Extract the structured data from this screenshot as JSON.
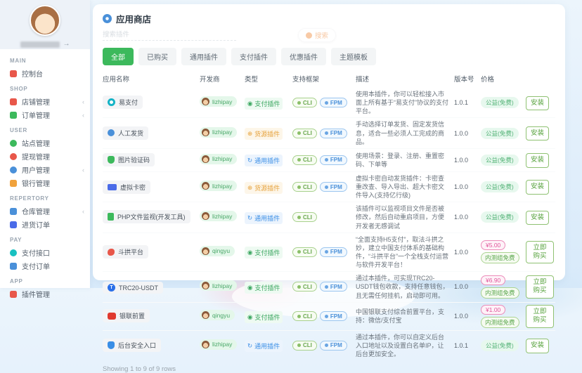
{
  "colors": {
    "accent_green": "#3cb95c",
    "type_pay_green": "#3aa65f",
    "type_stock_orange": "#e6a23c",
    "type_common_blue": "#3a8ee6",
    "cli_badge_green": "#6aa84f",
    "fpm_badge_blue": "#4a90d9",
    "price_paid_pink": "#e0549a",
    "free_badge_green": "#53b276",
    "search_orange": "#f08c3c"
  },
  "sidebar": {
    "groups": [
      {
        "label": "MAIN",
        "items": [
          {
            "label": "控制台",
            "icon": "dashboard-icon"
          }
        ]
      },
      {
        "label": "SHOP",
        "items": [
          {
            "label": "店铺管理",
            "icon": "shop-icon"
          },
          {
            "label": "订单管理",
            "icon": "orders-icon"
          }
        ]
      },
      {
        "label": "USER",
        "items": [
          {
            "label": "站点管理",
            "icon": "site-icon"
          },
          {
            "label": "提现管理",
            "icon": "withdraw-icon"
          },
          {
            "label": "用户管理",
            "icon": "users-icon"
          },
          {
            "label": "银行管理",
            "icon": "bank-icon"
          }
        ]
      },
      {
        "label": "REPERTORY",
        "items": [
          {
            "label": "仓库管理",
            "icon": "warehouse-icon"
          },
          {
            "label": "进货订单",
            "icon": "purchase-icon"
          }
        ]
      },
      {
        "label": "PAY",
        "items": [
          {
            "label": "支付接口",
            "icon": "pay-api-icon"
          },
          {
            "label": "支付订单",
            "icon": "pay-orders-icon"
          }
        ]
      },
      {
        "label": "APP",
        "items": [
          {
            "label": "插件管理",
            "icon": "plugins-icon"
          }
        ]
      }
    ]
  },
  "header": {
    "title": "应用商店",
    "search_placeholder": "搜索插件",
    "search_button": "搜索"
  },
  "tabs": {
    "items": [
      "全部",
      "已购买",
      "通用插件",
      "支付插件",
      "优惠插件",
      "主题模板"
    ],
    "active": "全部"
  },
  "table": {
    "columns": [
      "应用名称",
      "开发商",
      "类型",
      "支持框架",
      "描述",
      "版本号",
      "价格"
    ],
    "rows": [
      {
        "name": "易支付",
        "developer": "lizhipay",
        "type": "支付插件",
        "frameworks": [
          "CLI",
          "FPM"
        ],
        "description": "使用本插件，你可以轻松接入市面上所有基于“易支付”协议的支付平台。",
        "version": "1.0.1",
        "price_main": "公益(免费)",
        "action": "安装"
      },
      {
        "name": "人工发货",
        "developer": "lizhipay",
        "type": "货源插件",
        "frameworks": [
          "CLI",
          "FPM"
        ],
        "description": "手动选择订单发货、固定发货信息，适合一些必须人工完成的商品。",
        "version": "1.0.0",
        "price_main": "公益(免费)",
        "action": "安装"
      },
      {
        "name": "图片验证码",
        "developer": "lizhipay",
        "type": "通用插件",
        "frameworks": [
          "CLI",
          "FPM"
        ],
        "description": "使用场景：登录、注册、重置密码、下单等",
        "version": "1.0.0",
        "price_main": "公益(免费)",
        "action": "安装"
      },
      {
        "name": "虚拟卡密",
        "developer": "lizhipay",
        "type": "货源插件",
        "frameworks": [
          "CLI",
          "FPM"
        ],
        "description": "虚拟卡密自动发货插件：卡密查重改查、导入导出、超大卡密文件导入(支持亿行级)",
        "version": "1.0.0",
        "price_main": "公益(免费)",
        "action": "安装"
      },
      {
        "name": "PHP文件监视(开发工具)",
        "developer": "lizhipay",
        "type": "通用插件",
        "frameworks": [
          "CLI"
        ],
        "description": "该插件可以监视项目文件是否被修改，然后自动重启项目，方便开发者无感调试",
        "version": "1.0.0",
        "price_main": "公益(免费)",
        "action": "安装"
      },
      {
        "name": "斗拱平台",
        "developer": "qingyu",
        "type": "支付插件",
        "frameworks": [
          "CLI",
          "FPM"
        ],
        "description": "“全面支持H5支付”，取法斗拱之妙，建立中国支付体系的基础构件，“斗拱平台”一个全栈支付运营与软件开发平台！",
        "version": "1.0.0",
        "price_main": "¥5.00",
        "price_sub": "内测组免费",
        "action": "立即购买"
      },
      {
        "name": "TRC20-USDT",
        "developer": "lizhipay",
        "type": "支付插件",
        "frameworks": [
          "CLI",
          "FPM"
        ],
        "description": "通过本插件，可实现TRC20-USDT钱包收款，支持任意钱包，且无需任何挂机，启动即可用。",
        "version": "1.0.0",
        "price_main": "¥6.90",
        "price_sub": "内测组免费",
        "action": "立即购买"
      },
      {
        "name": "银联前置",
        "developer": "qingyu",
        "type": "支付插件",
        "frameworks": [
          "CLI",
          "FPM"
        ],
        "description": "中国银联支付综合前置平台，支持：微信/支付宝",
        "version": "1.0.0",
        "price_main": "¥1.00",
        "price_sub": "内测组免费",
        "action": "立即购买"
      },
      {
        "name": "后台安全入口",
        "developer": "lizhipay",
        "type": "通用插件",
        "frameworks": [
          "CLI",
          "FPM"
        ],
        "description": "通过本插件，你可以自定义后台入口地址以及设置白名单IP，让后台更加安全。",
        "version": "1.0.1",
        "price_main": "公益(免费)",
        "action": "安装"
      }
    ]
  },
  "footer": {
    "showing": "Showing 1 to 9 of 9 rows"
  }
}
